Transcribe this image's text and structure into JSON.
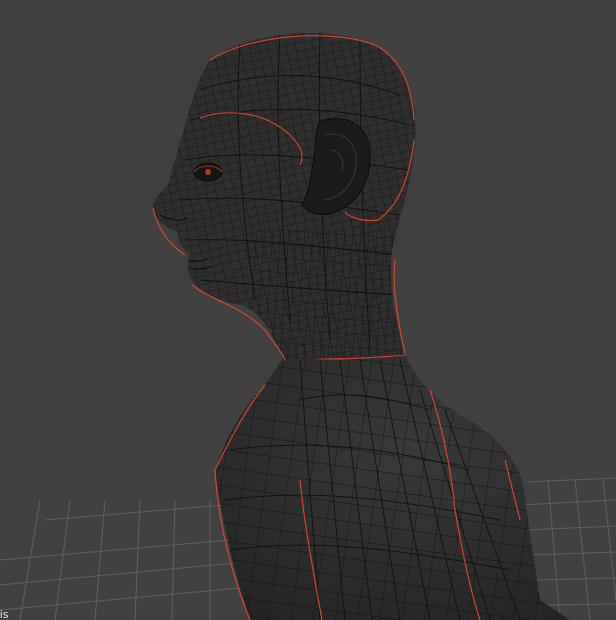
{
  "viewport": {
    "mode": "3D viewport",
    "display": "wireframe",
    "background_color": "#404040",
    "mesh_color": "#2e2e2e",
    "wire_color": "#111111",
    "seam_color": "#d9442a",
    "grid_color": "#6a6a6a"
  },
  "overlay": {
    "corner_text": "sis"
  }
}
